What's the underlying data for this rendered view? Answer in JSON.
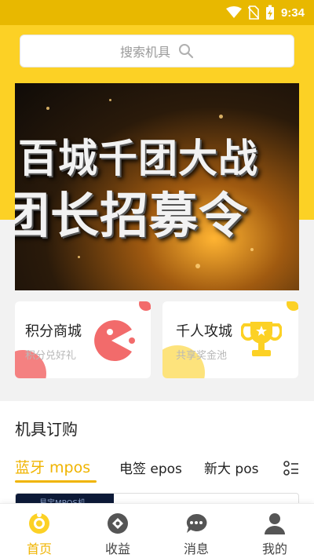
{
  "status_bar": {
    "time": "9:34",
    "icons": [
      "wifi-icon",
      "no-sim-icon",
      "battery-charging-icon"
    ]
  },
  "search": {
    "placeholder": "搜索机具"
  },
  "banner": {
    "line1": "百城千团大战",
    "line2": "团长招募令"
  },
  "cards": [
    {
      "title": "积分商城",
      "subtitle": "积分兑好礼",
      "icon": "pacman-icon",
      "accent": "#f26b6b"
    },
    {
      "title": "千人攻城",
      "subtitle": "共享奖金池",
      "icon": "trophy-icon",
      "accent": "#fcd125"
    }
  ],
  "section": {
    "title": "机具订购",
    "tabs": [
      {
        "label": "蓝牙 mpos",
        "active": true
      },
      {
        "label": "电签 epos",
        "active": false
      },
      {
        "label": "新大 pos",
        "active": false
      }
    ],
    "product_label": "易宝MPOS机"
  },
  "bottom_nav": [
    {
      "label": "首页",
      "icon": "home-icon",
      "active": true
    },
    {
      "label": "收益",
      "icon": "earnings-icon",
      "active": false
    },
    {
      "label": "消息",
      "icon": "message-icon",
      "active": false
    },
    {
      "label": "我的",
      "icon": "profile-icon",
      "active": false
    }
  ],
  "colors": {
    "brand_yellow": "#fcd125",
    "active_text": "#f0b400",
    "status_bar": "#e8b800"
  }
}
